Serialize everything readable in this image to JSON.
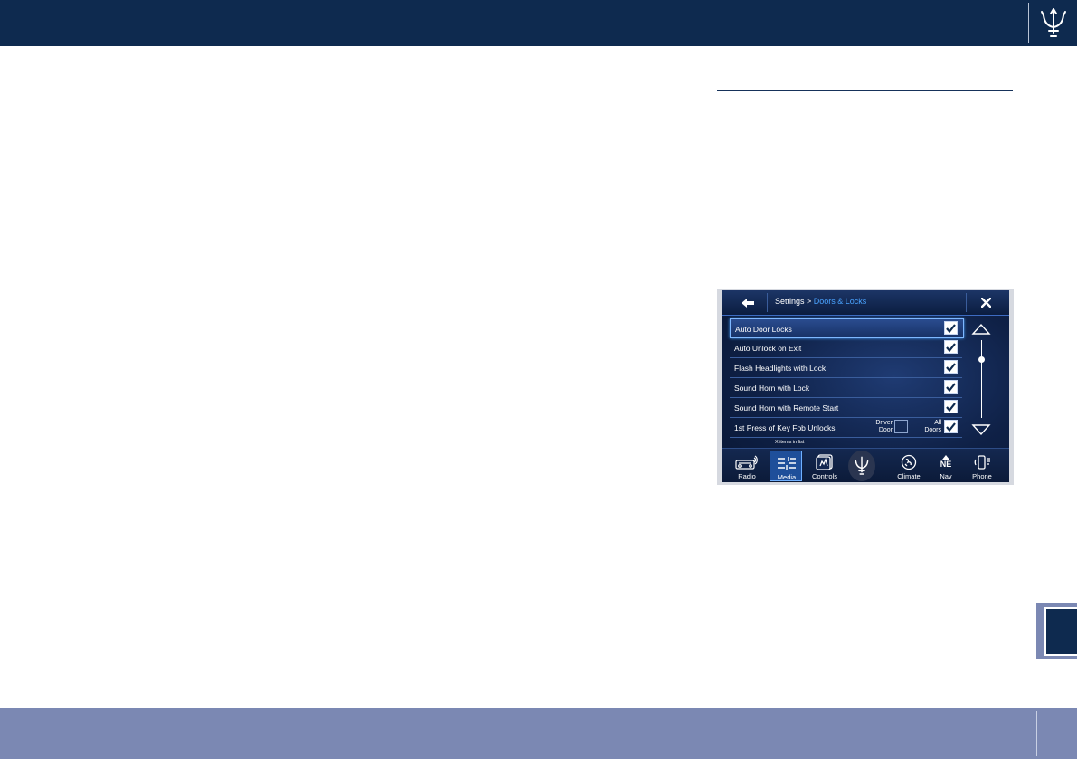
{
  "screen": {
    "header": {
      "title_prefix": "Settings > ",
      "title_crumb": "Doors & Locks"
    },
    "rows": [
      {
        "label": "Auto Door Locks",
        "checked": true
      },
      {
        "label": "Auto Unlock on Exit",
        "checked": true
      },
      {
        "label": "Flash Headlights with Lock",
        "checked": true
      },
      {
        "label": "Sound Horn with Lock",
        "checked": true
      },
      {
        "label": "Sound Horn with Remote Start",
        "checked": true
      },
      {
        "label": "1st Press of Key Fob Unlocks",
        "options": [
          {
            "label_line1": "Driver",
            "label_line2": "Door",
            "checked": false
          },
          {
            "label_line1": "All",
            "label_line2": "Doors",
            "checked": true
          }
        ]
      }
    ],
    "items_count": "X items in list",
    "nav": [
      {
        "label": "Radio",
        "icon": "radio-icon"
      },
      {
        "label": "Media",
        "icon": "media-icon",
        "active": true
      },
      {
        "label": "Controls",
        "icon": "controls-icon"
      },
      {
        "label": "Climate",
        "icon": "climate-icon"
      },
      {
        "label": "Nav",
        "icon": "compass-icon",
        "heading": "NE"
      },
      {
        "label": "Phone",
        "icon": "phone-icon"
      }
    ]
  },
  "colors": {
    "header_navy": "#0e2a4f",
    "footer_lavender": "#7b88b3",
    "accent_blue": "#4aa3ff"
  }
}
